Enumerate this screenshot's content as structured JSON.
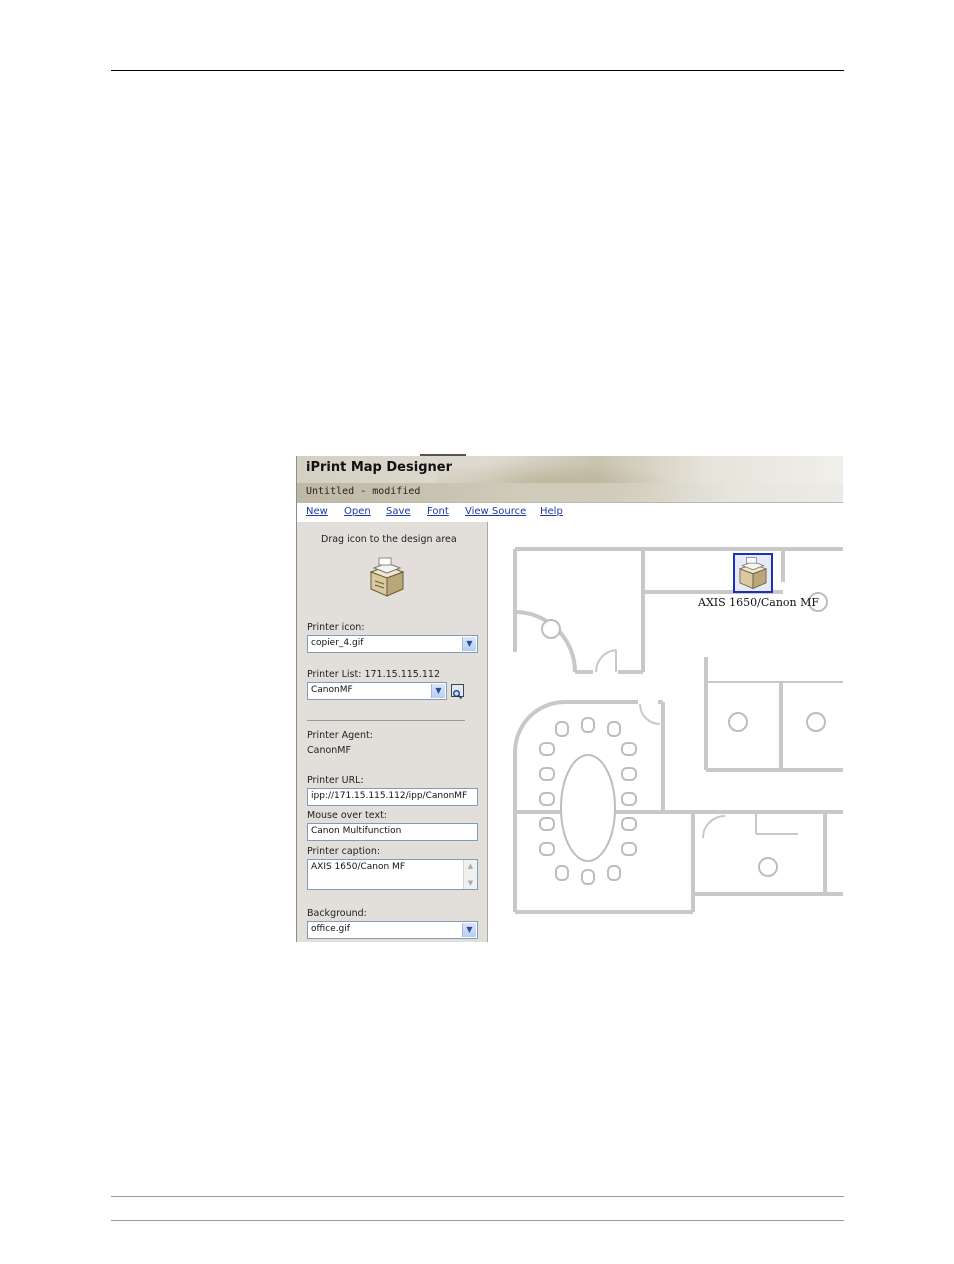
{
  "app": {
    "title": "iPrint Map Designer",
    "document_title": "Untitled - modified"
  },
  "menu": {
    "items": [
      "New",
      "Open",
      "Save",
      "Font",
      "View Source",
      "Help"
    ]
  },
  "sidebar": {
    "drag_hint": "Drag icon to the design area",
    "printer_icon_label": "Printer icon:",
    "printer_icon_value": "copier_4.gif",
    "printer_list_label": "Printer List: 171.15.115.112",
    "printer_list_value": "CanonMF",
    "printer_agent_label": "Printer Agent:",
    "printer_agent_value": "CanonMF",
    "printer_url_label": "Printer URL:",
    "printer_url_value": "ipp://171.15.115.112/ipp/CanonMF",
    "mouse_over_label": "Mouse over text:",
    "mouse_over_value": "Canon Multifunction",
    "caption_label": "Printer caption:",
    "caption_value": "AXIS 1650/Canon MF",
    "background_label": "Background:",
    "background_value": "office.gif"
  },
  "design_area": {
    "printer_caption": "AXIS 1650/Canon MF"
  },
  "icons": {
    "copier": "copier-icon",
    "search": "search-icon",
    "dropdown": "chevron-down-icon"
  },
  "colors": {
    "menu_link": "#1a3aa8",
    "selection": "#1c2fb8",
    "sidebar_bg": "#e2dfdb",
    "floorplan": "#c8c8c8"
  }
}
